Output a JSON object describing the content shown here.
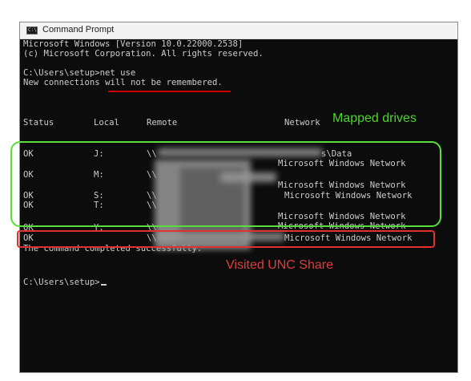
{
  "window": {
    "title": "Command Prompt",
    "icon_text": "C:\\"
  },
  "console": {
    "banner_line1": "Microsoft Windows [Version 10.0.22000.2538]",
    "banner_line2": "(c) Microsoft Corporation. All rights reserved.",
    "command": "C:\\Users\\setup>net use",
    "notice_prefix": "New connections ",
    "notice_emphasis": "will not be remembered.",
    "headers": {
      "status": "Status",
      "local": "Local",
      "remote": "Remote",
      "network": "Network"
    },
    "rows": [
      {
        "status": "OK",
        "local": "J:",
        "remote": "\\\\",
        "remote_suffix": "s\\Data",
        "network": "Microsoft Windows Network"
      },
      {
        "status": "OK",
        "local": "M:",
        "remote": "\\\\",
        "network": "Microsoft Windows Network"
      },
      {
        "status": "OK",
        "local": "S:",
        "remote": "\\\\",
        "network": "Microsoft Windows Network"
      },
      {
        "status": "OK",
        "local": "T:",
        "remote": "\\\\",
        "network": "Microsoft Windows Network"
      },
      {
        "status": "OK",
        "local": "Y:",
        "remote": "\\\\",
        "network": "Microsoft Windows Network"
      },
      {
        "status": "OK",
        "local": "",
        "remote": "\\\\",
        "network": "Microsoft Windows Network"
      }
    ],
    "completion": "The command completed successfully.",
    "prompt": "C:\\Users\\setup>"
  },
  "annotations": {
    "mapped_drives": "Mapped drives",
    "visited_unc": "Visited UNC Share"
  },
  "colors": {
    "console_bg": "#0c0c0c",
    "console_text": "#cccccc",
    "annotation_green": "#4fd42e",
    "annotation_red": "#e23b3b"
  }
}
